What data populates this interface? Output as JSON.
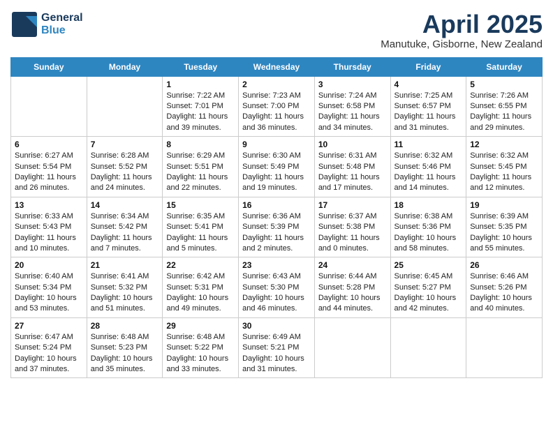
{
  "header": {
    "logo": {
      "general": "General",
      "blue": "Blue"
    },
    "title": "April 2025",
    "location": "Manutuke, Gisborne, New Zealand"
  },
  "calendar": {
    "weekdays": [
      "Sunday",
      "Monday",
      "Tuesday",
      "Wednesday",
      "Thursday",
      "Friday",
      "Saturday"
    ],
    "weeks": [
      [
        {
          "day": "",
          "info": ""
        },
        {
          "day": "",
          "info": ""
        },
        {
          "day": "1",
          "info": "Sunrise: 7:22 AM\nSunset: 7:01 PM\nDaylight: 11 hours and 39 minutes."
        },
        {
          "day": "2",
          "info": "Sunrise: 7:23 AM\nSunset: 7:00 PM\nDaylight: 11 hours and 36 minutes."
        },
        {
          "day": "3",
          "info": "Sunrise: 7:24 AM\nSunset: 6:58 PM\nDaylight: 11 hours and 34 minutes."
        },
        {
          "day": "4",
          "info": "Sunrise: 7:25 AM\nSunset: 6:57 PM\nDaylight: 11 hours and 31 minutes."
        },
        {
          "day": "5",
          "info": "Sunrise: 7:26 AM\nSunset: 6:55 PM\nDaylight: 11 hours and 29 minutes."
        }
      ],
      [
        {
          "day": "6",
          "info": "Sunrise: 6:27 AM\nSunset: 5:54 PM\nDaylight: 11 hours and 26 minutes."
        },
        {
          "day": "7",
          "info": "Sunrise: 6:28 AM\nSunset: 5:52 PM\nDaylight: 11 hours and 24 minutes."
        },
        {
          "day": "8",
          "info": "Sunrise: 6:29 AM\nSunset: 5:51 PM\nDaylight: 11 hours and 22 minutes."
        },
        {
          "day": "9",
          "info": "Sunrise: 6:30 AM\nSunset: 5:49 PM\nDaylight: 11 hours and 19 minutes."
        },
        {
          "day": "10",
          "info": "Sunrise: 6:31 AM\nSunset: 5:48 PM\nDaylight: 11 hours and 17 minutes."
        },
        {
          "day": "11",
          "info": "Sunrise: 6:32 AM\nSunset: 5:46 PM\nDaylight: 11 hours and 14 minutes."
        },
        {
          "day": "12",
          "info": "Sunrise: 6:32 AM\nSunset: 5:45 PM\nDaylight: 11 hours and 12 minutes."
        }
      ],
      [
        {
          "day": "13",
          "info": "Sunrise: 6:33 AM\nSunset: 5:43 PM\nDaylight: 11 hours and 10 minutes."
        },
        {
          "day": "14",
          "info": "Sunrise: 6:34 AM\nSunset: 5:42 PM\nDaylight: 11 hours and 7 minutes."
        },
        {
          "day": "15",
          "info": "Sunrise: 6:35 AM\nSunset: 5:41 PM\nDaylight: 11 hours and 5 minutes."
        },
        {
          "day": "16",
          "info": "Sunrise: 6:36 AM\nSunset: 5:39 PM\nDaylight: 11 hours and 2 minutes."
        },
        {
          "day": "17",
          "info": "Sunrise: 6:37 AM\nSunset: 5:38 PM\nDaylight: 11 hours and 0 minutes."
        },
        {
          "day": "18",
          "info": "Sunrise: 6:38 AM\nSunset: 5:36 PM\nDaylight: 10 hours and 58 minutes."
        },
        {
          "day": "19",
          "info": "Sunrise: 6:39 AM\nSunset: 5:35 PM\nDaylight: 10 hours and 55 minutes."
        }
      ],
      [
        {
          "day": "20",
          "info": "Sunrise: 6:40 AM\nSunset: 5:34 PM\nDaylight: 10 hours and 53 minutes."
        },
        {
          "day": "21",
          "info": "Sunrise: 6:41 AM\nSunset: 5:32 PM\nDaylight: 10 hours and 51 minutes."
        },
        {
          "day": "22",
          "info": "Sunrise: 6:42 AM\nSunset: 5:31 PM\nDaylight: 10 hours and 49 minutes."
        },
        {
          "day": "23",
          "info": "Sunrise: 6:43 AM\nSunset: 5:30 PM\nDaylight: 10 hours and 46 minutes."
        },
        {
          "day": "24",
          "info": "Sunrise: 6:44 AM\nSunset: 5:28 PM\nDaylight: 10 hours and 44 minutes."
        },
        {
          "day": "25",
          "info": "Sunrise: 6:45 AM\nSunset: 5:27 PM\nDaylight: 10 hours and 42 minutes."
        },
        {
          "day": "26",
          "info": "Sunrise: 6:46 AM\nSunset: 5:26 PM\nDaylight: 10 hours and 40 minutes."
        }
      ],
      [
        {
          "day": "27",
          "info": "Sunrise: 6:47 AM\nSunset: 5:24 PM\nDaylight: 10 hours and 37 minutes."
        },
        {
          "day": "28",
          "info": "Sunrise: 6:48 AM\nSunset: 5:23 PM\nDaylight: 10 hours and 35 minutes."
        },
        {
          "day": "29",
          "info": "Sunrise: 6:48 AM\nSunset: 5:22 PM\nDaylight: 10 hours and 33 minutes."
        },
        {
          "day": "30",
          "info": "Sunrise: 6:49 AM\nSunset: 5:21 PM\nDaylight: 10 hours and 31 minutes."
        },
        {
          "day": "",
          "info": ""
        },
        {
          "day": "",
          "info": ""
        },
        {
          "day": "",
          "info": ""
        }
      ]
    ]
  }
}
